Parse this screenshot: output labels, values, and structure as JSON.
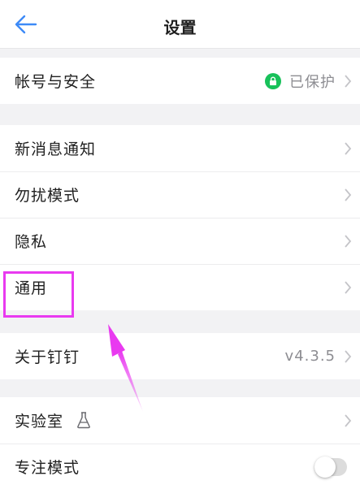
{
  "header": {
    "title": "设置",
    "back_icon": "back-arrow-icon"
  },
  "groups": [
    {
      "items": [
        {
          "label": "帐号与安全",
          "value": "已保护",
          "badge_icon": "lock-icon"
        }
      ]
    },
    {
      "items": [
        {
          "label": "新消息通知"
        },
        {
          "label": "勿扰模式"
        },
        {
          "label": "隐私"
        },
        {
          "label": "通用"
        }
      ]
    },
    {
      "items": [
        {
          "label": "关于钉钉",
          "value": "v4.3.5"
        }
      ]
    },
    {
      "items": [
        {
          "label": "实验室",
          "icon": "flask-icon"
        },
        {
          "label": "专注模式",
          "toggle": false
        }
      ]
    }
  ],
  "colors": {
    "accent": "#3d8af7",
    "badge_green": "#18c15a",
    "annotation": "#e93af0",
    "background": "#f2f2f4"
  }
}
